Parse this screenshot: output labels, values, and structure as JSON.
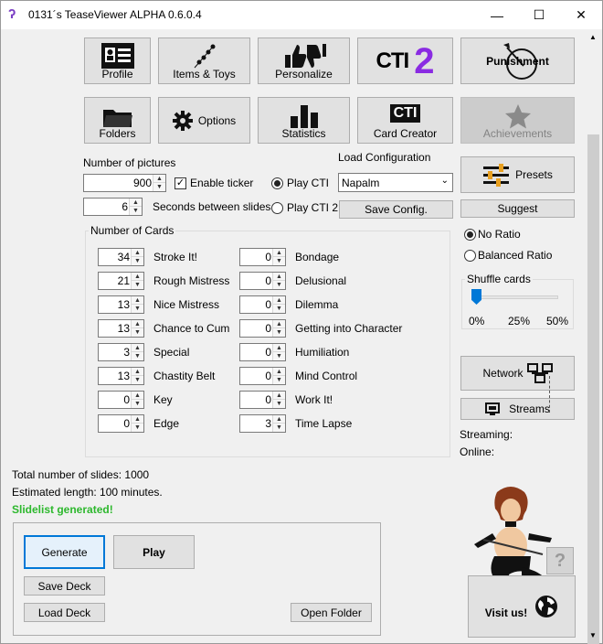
{
  "window": {
    "title": "0131´s TeaseViewer ALPHA 0.6.0.4",
    "minimize": "—",
    "maximize": "☐",
    "close": "✕"
  },
  "toolbar": {
    "profile": "Profile",
    "items_toys": "Items & Toys",
    "personalize": "Personalize",
    "cti_text": "CTI",
    "cti_number": "2",
    "punishment": "Punishment",
    "folders": "Folders",
    "options": "Options",
    "statistics": "Statistics",
    "card_creator": "Card Creator",
    "card_creator_badge": "CTI",
    "achievements": "Achievements"
  },
  "settings": {
    "num_pictures_label": "Number of pictures",
    "num_pictures": "900",
    "enable_ticker": "Enable ticker",
    "enable_ticker_checked": true,
    "seconds_value": "6",
    "seconds_label": "Seconds between slides",
    "play_cti": "Play CTI",
    "play_cti2": "Play CTI 2",
    "load_config_label": "Load Configuration",
    "load_config_value": "Napalm",
    "save_config": "Save Config.",
    "presets": "Presets",
    "suggest": "Suggest"
  },
  "cards": {
    "group_title": "Number of Cards",
    "left": [
      {
        "value": "34",
        "label": "Stroke It!"
      },
      {
        "value": "21",
        "label": "Rough Mistress"
      },
      {
        "value": "13",
        "label": "Nice Mistress"
      },
      {
        "value": "13",
        "label": "Chance to Cum"
      },
      {
        "value": "3",
        "label": "Special"
      },
      {
        "value": "13",
        "label": "Chastity Belt"
      },
      {
        "value": "0",
        "label": "Key"
      },
      {
        "value": "0",
        "label": "Edge"
      }
    ],
    "right": [
      {
        "value": "0",
        "label": "Bondage"
      },
      {
        "value": "0",
        "label": "Delusional"
      },
      {
        "value": "0",
        "label": "Dilemma"
      },
      {
        "value": "0",
        "label": "Getting into Character"
      },
      {
        "value": "0",
        "label": "Humiliation"
      },
      {
        "value": "0",
        "label": "Mind Control"
      },
      {
        "value": "0",
        "label": "Work It!"
      },
      {
        "value": "3",
        "label": "Time Lapse"
      }
    ]
  },
  "ratio": {
    "no_ratio": "No Ratio",
    "balanced": "Balanced Ratio"
  },
  "shuffle": {
    "title": "Shuffle cards",
    "t0": "0%",
    "t1": "25%",
    "t2": "50%",
    "level": 0
  },
  "network": {
    "network": "Network",
    "streams": "Streams",
    "streaming_label": "Streaming:",
    "online_label": "Online:"
  },
  "summary": {
    "total": "Total number of slides: 1000",
    "length": "Estimated length: 100 minutes.",
    "status": "Slidelist generated!",
    "status_color": "#2db82d"
  },
  "actions": {
    "generate": "Generate",
    "play": "Play",
    "save_deck": "Save Deck",
    "load_deck": "Load Deck",
    "open_folder": "Open Folder"
  },
  "promo": {
    "visit_us": "Visit us!",
    "help": "?"
  },
  "icons": [
    "profile-icon",
    "items-toys-icon",
    "personalize-icon",
    "punishment-icon",
    "folder-icon",
    "gear-icon",
    "statistics-icon",
    "star-icon",
    "sliders-icon",
    "network-icon",
    "streams-icon",
    "globe-icon"
  ]
}
